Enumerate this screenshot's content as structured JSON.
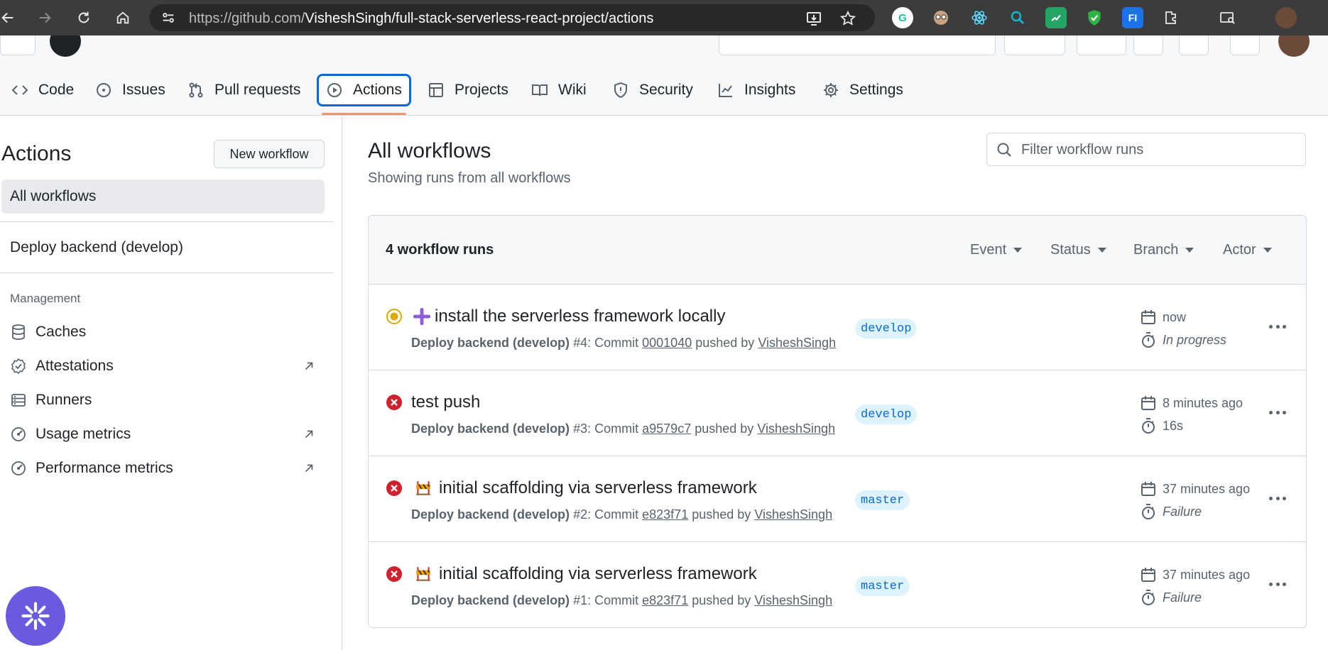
{
  "browser": {
    "url_prefix": "https://github.com/",
    "url_path": "VisheshSingh/full-stack-serverless-react-project/actions",
    "extensions": [
      {
        "name": "grammarly-extension-icon",
        "label": "G",
        "color": "#15c39a"
      },
      {
        "name": "eyes-extension-icon",
        "label": "",
        "color": "#8a6a4f"
      },
      {
        "name": "react-devtools-extension-icon",
        "label": "",
        "color": "#61dafb"
      },
      {
        "name": "search-extension-icon",
        "label": "",
        "color": "#1a9bbd"
      },
      {
        "name": "sheets-extension-icon",
        "label": "",
        "color": "#23a566"
      },
      {
        "name": "shield-extension-icon",
        "label": "",
        "color": "#2fb344"
      },
      {
        "name": "fi-extension-icon",
        "label": "FI",
        "color": "#1a73e8"
      },
      {
        "name": "puzzle-extensions-icon",
        "label": "",
        "color": "#3c3c3c"
      }
    ]
  },
  "repo_tabs": [
    {
      "name": "tab-code",
      "label": "Code",
      "icon": "code-icon"
    },
    {
      "name": "tab-issues",
      "label": "Issues",
      "icon": "issue-icon"
    },
    {
      "name": "tab-pull-requests",
      "label": "Pull requests",
      "icon": "pull-request-icon"
    },
    {
      "name": "tab-actions",
      "label": "Actions",
      "icon": "play-icon",
      "active": true
    },
    {
      "name": "tab-projects",
      "label": "Projects",
      "icon": "table-icon"
    },
    {
      "name": "tab-wiki",
      "label": "Wiki",
      "icon": "book-icon"
    },
    {
      "name": "tab-security",
      "label": "Security",
      "icon": "shield-icon"
    },
    {
      "name": "tab-insights",
      "label": "Insights",
      "icon": "graph-icon"
    },
    {
      "name": "tab-settings",
      "label": "Settings",
      "icon": "gear-icon"
    }
  ],
  "sidebar": {
    "title": "Actions",
    "new_workflow": "New workflow",
    "all_workflows": "All workflows",
    "workflow": "Deploy backend (develop)",
    "management_label": "Management",
    "management": [
      {
        "label": "Caches",
        "icon": "database-icon",
        "external": false
      },
      {
        "label": "Attestations",
        "icon": "verified-icon",
        "external": true
      },
      {
        "label": "Runners",
        "icon": "server-icon",
        "external": false
      },
      {
        "label": "Usage metrics",
        "icon": "meter-icon",
        "external": true
      },
      {
        "label": "Performance metrics",
        "icon": "meter-icon",
        "external": true
      }
    ]
  },
  "main": {
    "title": "All workflows",
    "subtitle": "Showing runs from all workflows",
    "filter_placeholder": "Filter workflow runs",
    "runs_count": "4 workflow runs",
    "filters": [
      "Event",
      "Status",
      "Branch",
      "Actor"
    ]
  },
  "runs": [
    {
      "status": "in-progress",
      "emoji": "plus-emoji",
      "title": "install the serverless framework locally",
      "workflow": "Deploy backend (develop)",
      "number": "#4",
      "commit_label": "Commit",
      "commit": "0001040",
      "pushed_by": "pushed by",
      "actor": "VisheshSingh",
      "branch": "develop",
      "when": "now",
      "duration": "In progress",
      "duration_italic": true
    },
    {
      "status": "failure",
      "emoji": "",
      "title": "test push",
      "workflow": "Deploy backend (develop)",
      "number": "#3",
      "commit_label": "Commit",
      "commit": "a9579c7",
      "pushed_by": "pushed by",
      "actor": "VisheshSingh",
      "branch": "develop",
      "when": "8 minutes ago",
      "duration": "16s",
      "duration_italic": false
    },
    {
      "status": "failure",
      "emoji": "construction-emoji",
      "title": "initial scaffolding via serverless framework",
      "workflow": "Deploy backend (develop)",
      "number": "#2",
      "commit_label": "Commit",
      "commit": "e823f71",
      "pushed_by": "pushed by",
      "actor": "VisheshSingh",
      "branch": "master",
      "when": "37 minutes ago",
      "duration": "Failure",
      "duration_italic": true
    },
    {
      "status": "failure",
      "emoji": "construction-emoji",
      "title": "initial scaffolding via serverless framework",
      "workflow": "Deploy backend (develop)",
      "number": "#1",
      "commit_label": "Commit",
      "commit": "e823f71",
      "pushed_by": "pushed by",
      "actor": "VisheshSingh",
      "branch": "master",
      "when": "37 minutes ago",
      "duration": "Failure",
      "duration_italic": true
    }
  ],
  "colors": {
    "accent": "#0969da",
    "failure": "#cf222e",
    "in_progress": "#dbab0a",
    "chat_fab": "#6a5ae0"
  }
}
